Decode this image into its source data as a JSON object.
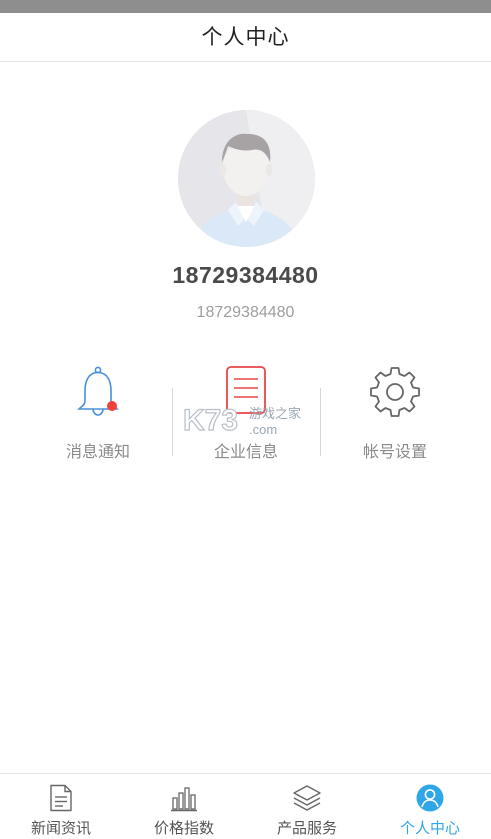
{
  "header": {
    "title": "个人中心"
  },
  "profile": {
    "phone": "18729384480",
    "account": "18729384480"
  },
  "functions": [
    {
      "label": "消息通知",
      "icon": "bell-icon",
      "has_unread_dot": true
    },
    {
      "label": "企业信息",
      "icon": "document-icon"
    },
    {
      "label": "帐号设置",
      "icon": "gear-icon"
    }
  ],
  "watermark": {
    "brand": "K73",
    "text": "游戏之家",
    "domain": ".com"
  },
  "tabs": [
    {
      "label": "新闻资讯",
      "icon": "news-doc-icon",
      "active": false
    },
    {
      "label": "价格指数",
      "icon": "bar-chart-icon",
      "active": false
    },
    {
      "label": "产品服务",
      "icon": "layers-icon",
      "active": false
    },
    {
      "label": "个人中心",
      "icon": "user-icon",
      "active": true
    }
  ],
  "colors": {
    "accent": "#2fa6e8",
    "badge": "#f0403a",
    "bell": "#4a90d9",
    "doc": "#e8464a"
  }
}
